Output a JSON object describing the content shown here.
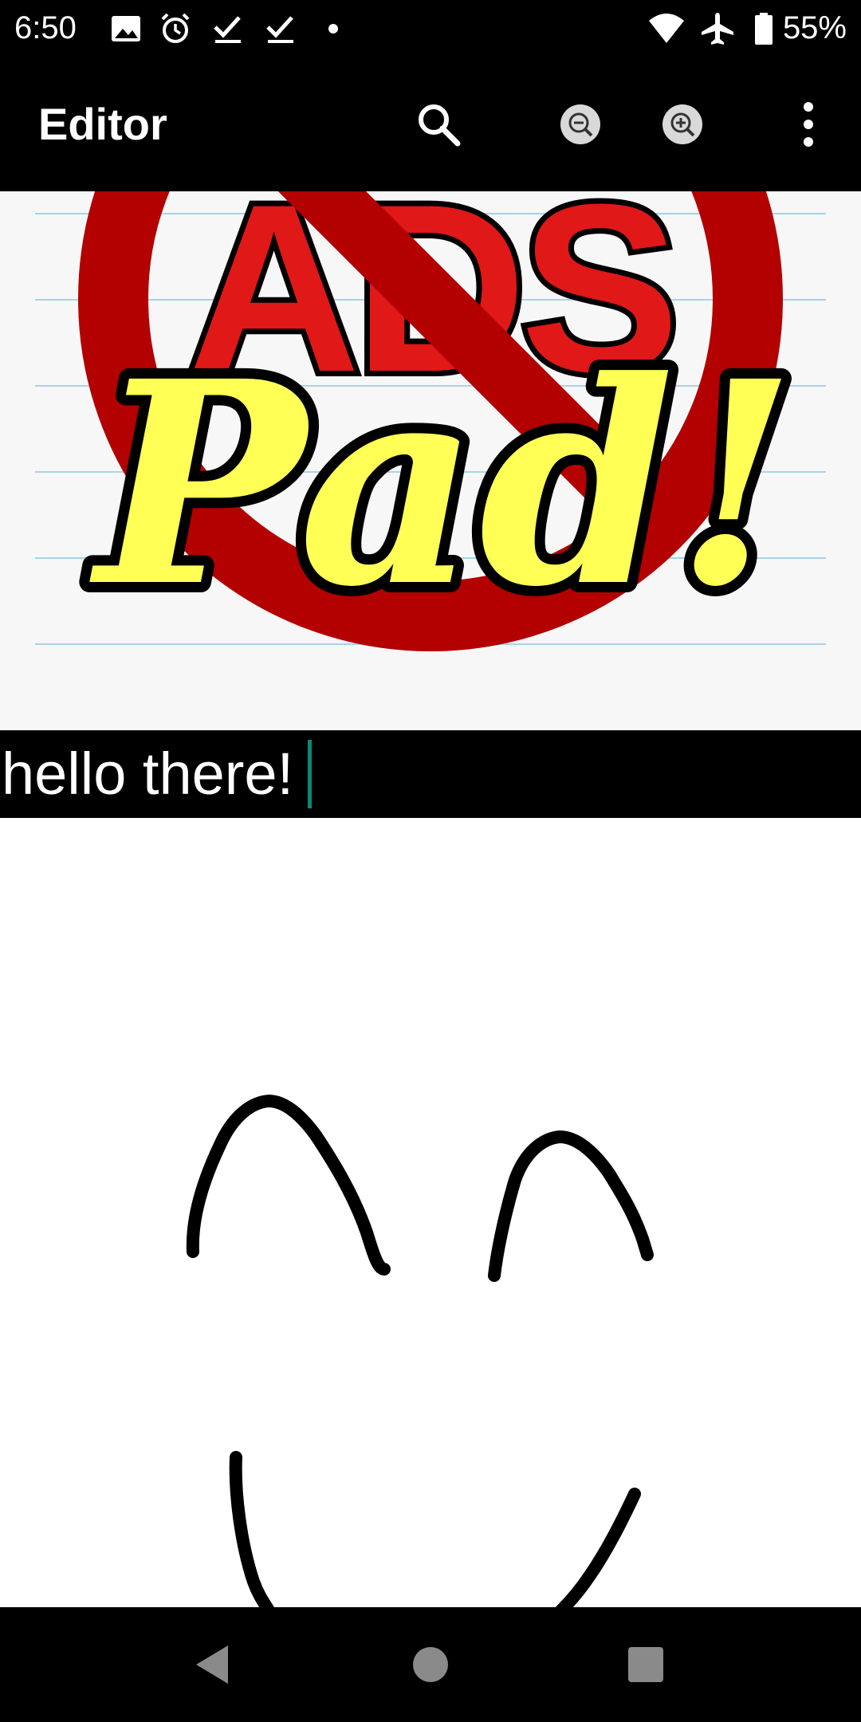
{
  "status_bar": {
    "time": "6:50",
    "battery_percent": "55%",
    "icons": [
      "image-icon",
      "alarm-icon",
      "checkmark-icon",
      "checkmark-icon",
      "notification-dot-icon",
      "wifi-icon",
      "airplane-mode-icon",
      "battery-icon"
    ]
  },
  "app_bar": {
    "title": "Editor",
    "actions": [
      "search-icon",
      "zoom-out-icon",
      "zoom-in-icon",
      "more-vert-icon"
    ]
  },
  "banner": {
    "crossed_text": "ADS",
    "logo_text": "Pad!",
    "colors": {
      "prohibition_red": "#b30000",
      "text_red": "#e01818",
      "logo_yellow": "#ffff55",
      "rule_line": "#a8d3e6"
    }
  },
  "editor": {
    "text": "hello there!",
    "caret_color": "#0b8a74"
  },
  "nav_bar": {
    "buttons": [
      "back-icon",
      "home-icon",
      "recents-icon"
    ]
  }
}
